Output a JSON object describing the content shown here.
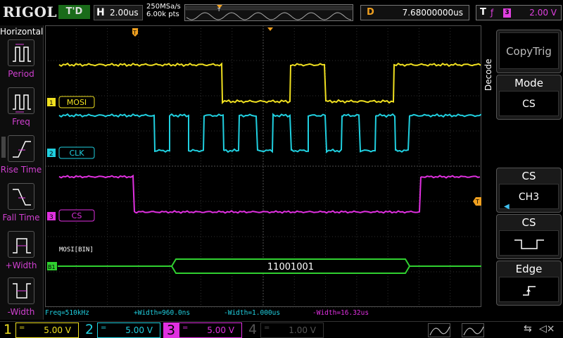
{
  "topbar": {
    "logo": "RIGOL",
    "run_state": "T'D",
    "horizontal": {
      "key": "H",
      "value": "2.00us"
    },
    "sample_rate": "250MSa/s",
    "memory_depth": "6.00k pts",
    "delay": {
      "key": "D",
      "value": "7.68000000us"
    },
    "trigger": {
      "key": "T",
      "edge": "ƒ",
      "channel": "3",
      "level": "2.00 V"
    }
  },
  "left_panel": {
    "title": "Horizontal",
    "items": [
      {
        "label": "Period"
      },
      {
        "label": "Freq"
      },
      {
        "label": "Rise Time"
      },
      {
        "label": "Fall Time"
      },
      {
        "label": "+Width"
      },
      {
        "label": "-Width"
      }
    ]
  },
  "channels": {
    "mosi_label": "MOSI",
    "clk_label": "CLK",
    "cs_label": "CS",
    "bus_title": "MOSI[BIN]",
    "bus_value": "11001001",
    "marker_1": "1",
    "marker_2": "2",
    "marker_3": "3",
    "marker_b": "B1",
    "trigger_marker": "T"
  },
  "measurements": {
    "freq": "Freq=510kHz",
    "pwidth": "+Width=960.0ns",
    "nwidth": "-Width=1.000us",
    "nwidth3": "-Width=16.32us"
  },
  "right_menu": {
    "title": "Decode",
    "copytrig": "CopyTrig",
    "mode": {
      "header": "Mode",
      "value": "CS"
    },
    "cs": {
      "header": "CS",
      "value": "CH3"
    },
    "cs_polarity": {
      "header": "CS"
    },
    "edge": {
      "header": "Edge"
    }
  },
  "bottombar": {
    "ch1": {
      "num": "1",
      "coupling": "=",
      "scale": "5.00 V"
    },
    "ch2": {
      "num": "2",
      "coupling": "=",
      "scale": "5.00 V"
    },
    "ch3": {
      "num": "3",
      "coupling": "=",
      "scale": "5.00 V"
    },
    "ch4": {
      "num": "4",
      "coupling": "=",
      "scale": "1.00 V"
    }
  },
  "colors": {
    "ch1": "#f0e020",
    "ch2": "#20d0e0",
    "ch3": "#e030e0",
    "ch4": "#4060e0",
    "bus": "#30d030",
    "trigger": "#f0a020"
  }
}
